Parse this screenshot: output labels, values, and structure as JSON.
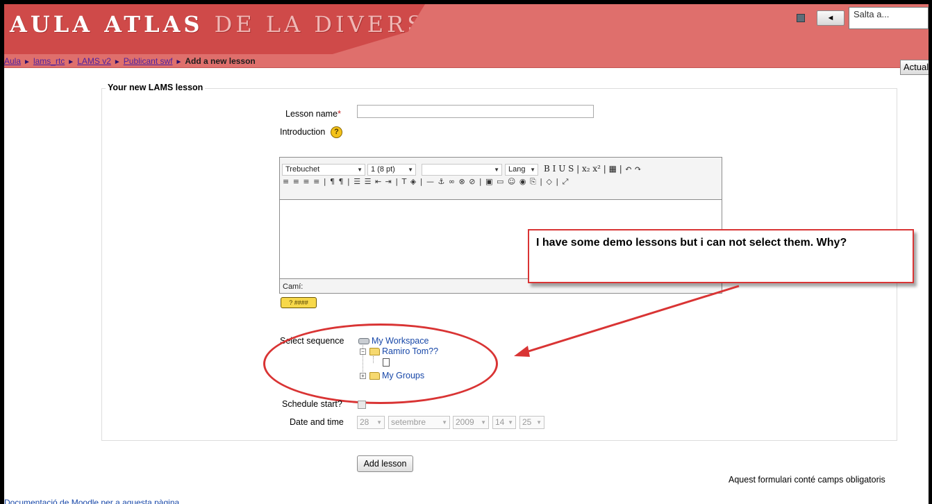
{
  "header": {
    "logo_text": "AULA ATLAS DE LA DIVERSIDAD",
    "logo_bright": "AULA ATLAS",
    "logo_dim": "DE LA DIVERSIDAD",
    "back_button": "◄",
    "jump_select": "Salta a..."
  },
  "breadcrumb": {
    "items": [
      "Aula",
      "lams_rtc",
      "LAMS v2",
      "Publicant swf"
    ],
    "current": "Add a new lesson",
    "separator": "►"
  },
  "update_button": "Actual",
  "form": {
    "legend": "Your new LAMS lesson",
    "lesson_name_label": "Lesson name",
    "required_marker": "*",
    "lesson_name_value": "",
    "introduction_label": "Introduction",
    "help_icon_text": "?",
    "editor": {
      "font_family": "Trebuchet",
      "font_size": "1 (8 pt)",
      "format": "",
      "lang": "Lang",
      "row1_buttons": "B  I  U  S  |  x₂  x²  |  ▦  |  ↶  ↷",
      "row2_buttons": "≡ ≡ ≡ ≡ | ¶ ¶ | ☰ ☰ ⇤ ⇥ | T ◈ | — ⚓ ∞ ⊗ ⊘ | ▣ ▭ ☺ ◉ ⎘ | ◇ | ⤢",
      "path_label": "Camí:",
      "keyboard_help": "? ####"
    },
    "select_sequence_label": "Select sequence",
    "tree": {
      "root": "My Workspace",
      "folder1": "Ramiro Tom??",
      "folder2": "My Groups",
      "expand_minus": "−",
      "expand_plus": "+"
    },
    "schedule_start_label": "Schedule start?",
    "date_time_label": "Date and time",
    "date": {
      "day": "28",
      "month": "setembre",
      "year": "2009",
      "hour": "14",
      "minute": "25"
    },
    "add_lesson_button": "Add lesson",
    "required_note": "Aquest formulari conté camps obligatoris"
  },
  "footer": {
    "docs_link": "Documentació de Moodle per a aquesta pàgina"
  },
  "annotation": {
    "text": "I have some demo lessons but i can not select them. Why?",
    "color": "#d93434"
  },
  "colors": {
    "header_bg": "#df6f6c",
    "link": "#1747a8"
  }
}
